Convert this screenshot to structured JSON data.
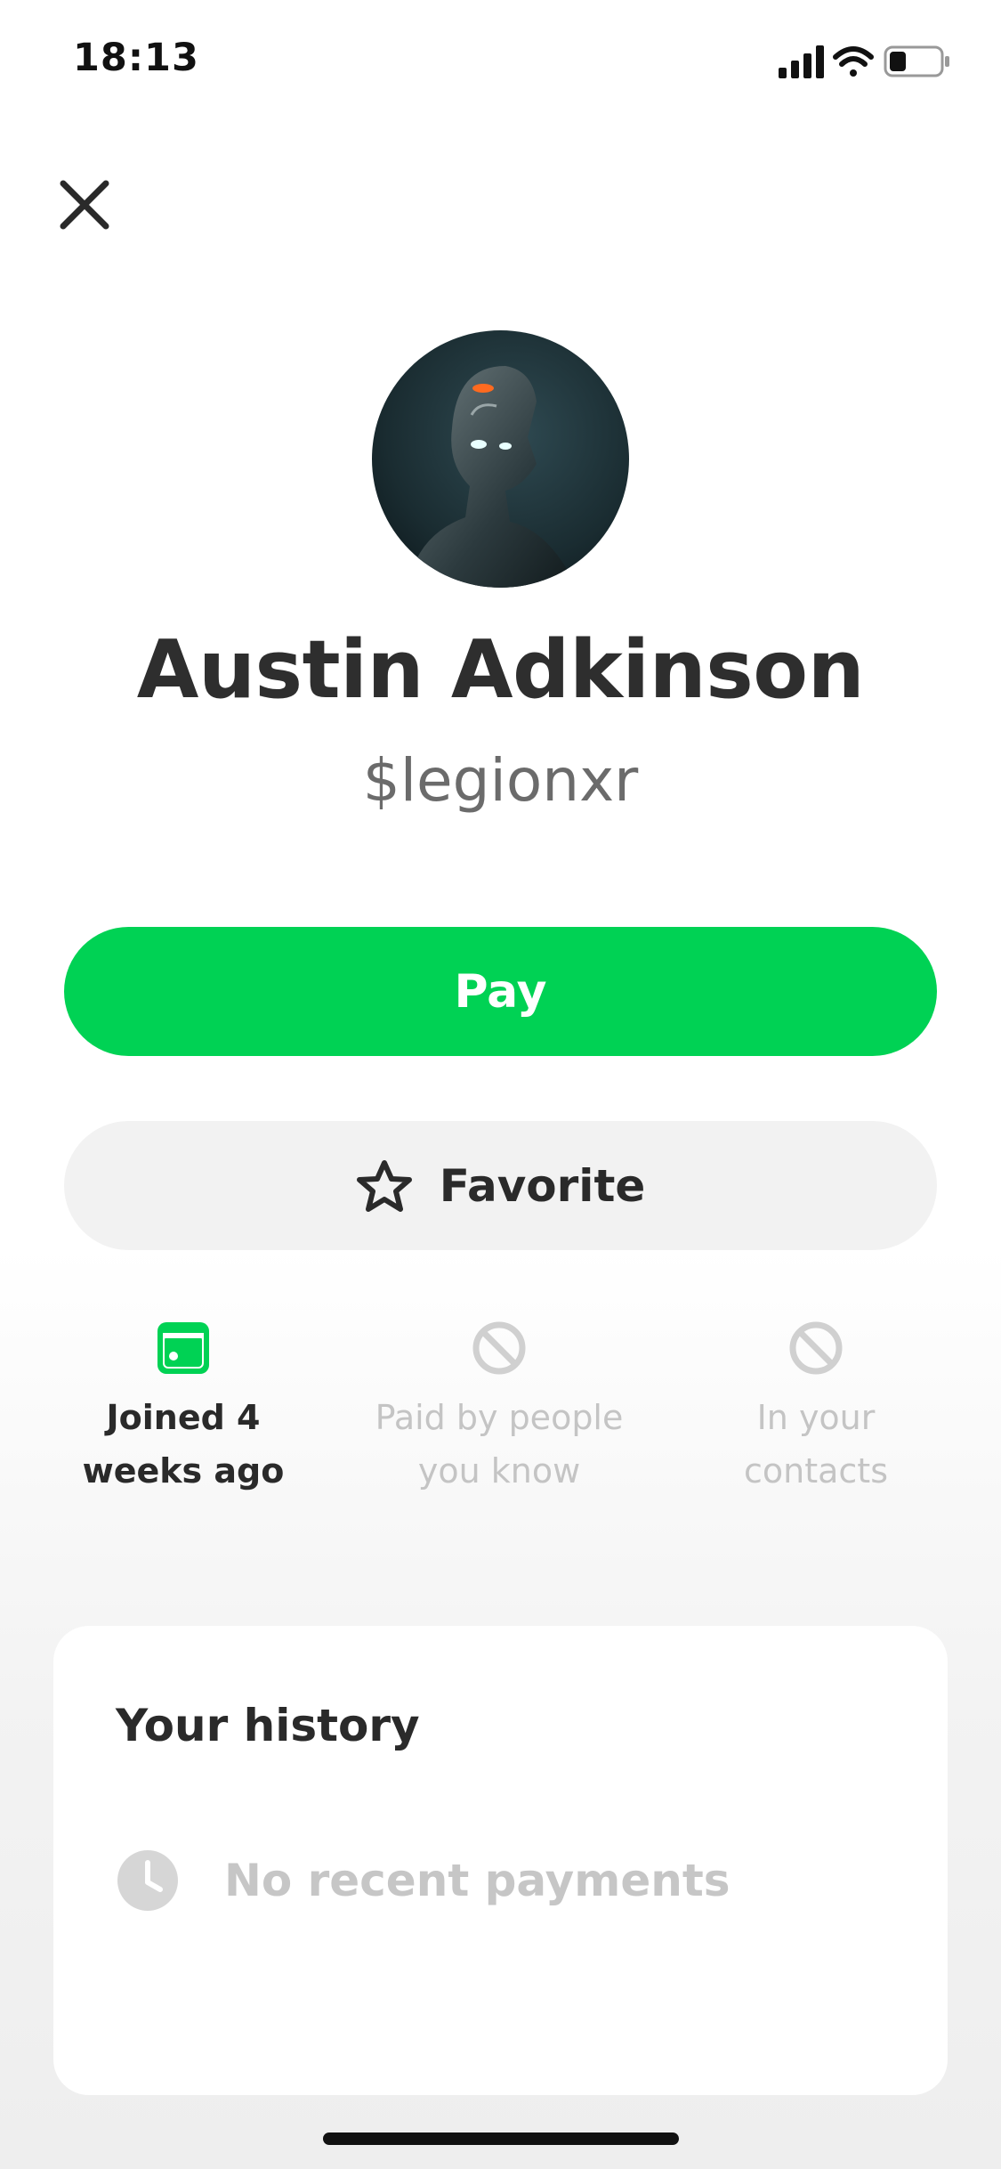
{
  "status_bar": {
    "time": "18:13"
  },
  "profile": {
    "name": "Austin Adkinson",
    "cashtag": "$legionxr"
  },
  "actions": {
    "pay_label": "Pay",
    "favorite_label": "Favorite"
  },
  "facts": [
    {
      "label": "Joined 4 weeks ago",
      "icon": "calendar-card-icon",
      "active": true
    },
    {
      "label": "Paid by people you know",
      "icon": "prohibited-icon",
      "active": false
    },
    {
      "label": "In your contacts",
      "icon": "prohibited-icon",
      "active": false
    }
  ],
  "history": {
    "title": "Your history",
    "empty_text": "No recent payments"
  },
  "colors": {
    "accent_green": "#00d254",
    "text_primary": "#2e2e2e",
    "text_secondary": "#6b6b6b",
    "text_muted": "#c4c4c4"
  }
}
